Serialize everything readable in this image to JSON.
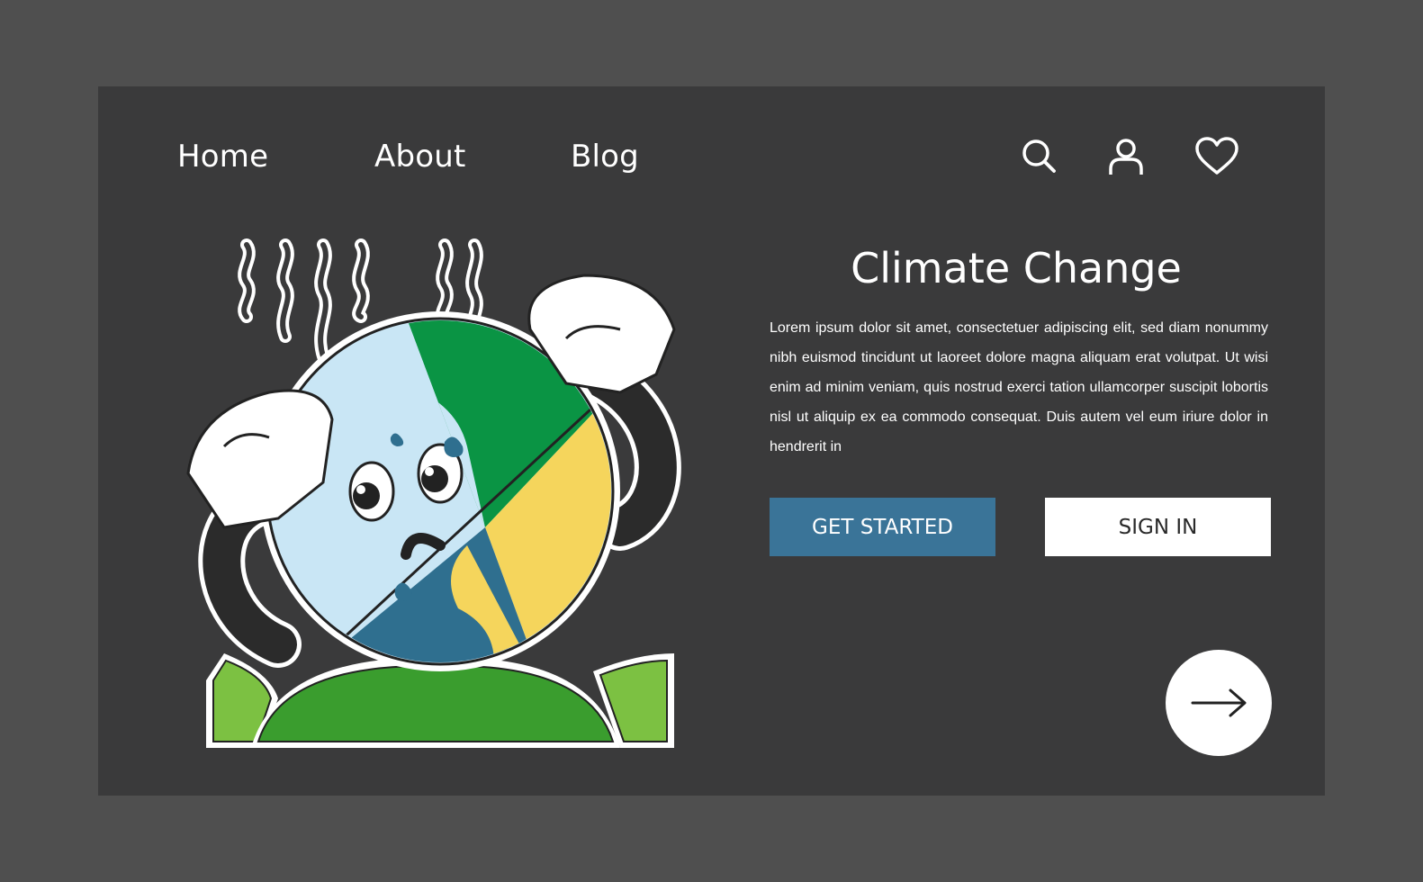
{
  "nav": {
    "home": "Home",
    "about": "About",
    "blog": "Blog"
  },
  "icons": {
    "search": "search-icon",
    "user": "user-icon",
    "favorite": "heart-icon",
    "next": "arrow-right-icon"
  },
  "hero": {
    "title": "Climate Change",
    "body": "Lorem ipsum dolor sit amet, consectetuer adipiscing elit, sed diam nonummy nibh euismod tincidunt ut laoreet dolore magna aliquam erat volutpat. Ut wisi enim ad minim veniam, quis nostrud exerci tation ullamcorper suscipit lobortis nisl ut aliquip ex ea commodo consequat. Duis autem vel eum iriure dolor in hendrerit in"
  },
  "buttons": {
    "get_started": "GET STARTED",
    "sign_in": "SIGN IN"
  },
  "colors": {
    "page_bg": "#4f4f4f",
    "frame_bg": "#3a3a3b",
    "primary": "#3a7498",
    "globe_ocean_light": "#c9e6f5",
    "globe_land_green": "#0a9444",
    "globe_land_yellow": "#f5d55c",
    "globe_ocean_dark": "#2f6f8f",
    "grass": "#3a9d2e",
    "leaf": "#7cc142"
  }
}
